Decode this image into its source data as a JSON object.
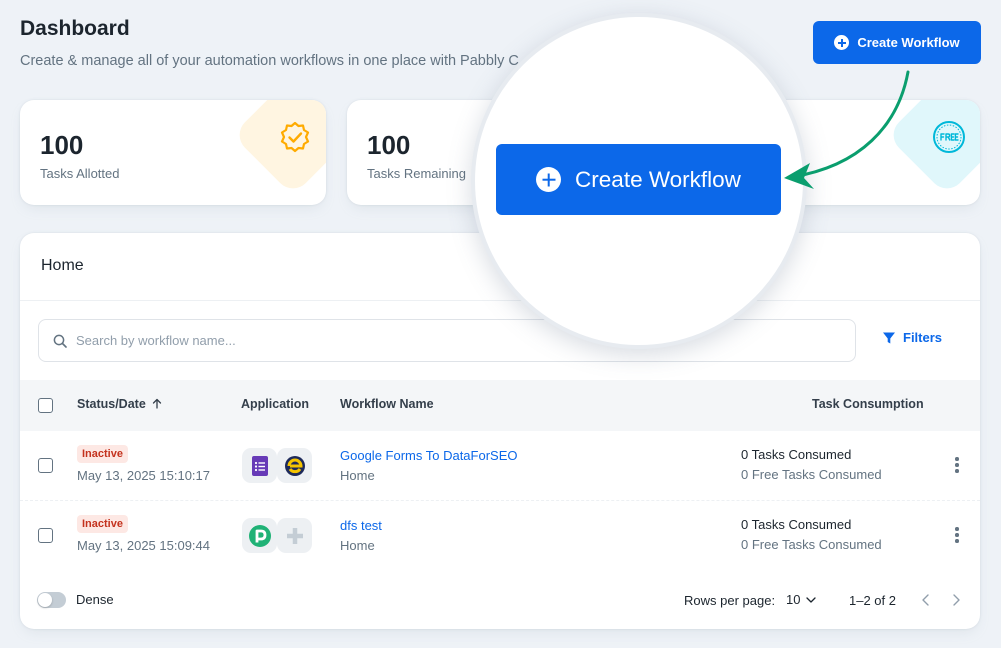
{
  "header": {
    "title": "Dashboard",
    "subtitle": "Create & manage all of your automation workflows in one place with Pabbly C"
  },
  "create_button": {
    "label": "Create Workflow"
  },
  "magnified_button": {
    "label": "Create Workflow"
  },
  "stats": [
    {
      "value": "100",
      "label": "Tasks Allotted",
      "icon": "verified-badge-icon",
      "accent": "#ffab00"
    },
    {
      "value": "100",
      "label": "Tasks Remaining",
      "icon": "",
      "accent": ""
    },
    {
      "value": "",
      "label": "",
      "icon": "free-badge-icon",
      "accent": "#00b8d9"
    }
  ],
  "workflows_panel": {
    "title": "Home",
    "search": {
      "placeholder": "Search by workflow name...",
      "value": ""
    },
    "filters_label": "Filters",
    "columns": {
      "status_date": "Status/Date",
      "application": "Application",
      "workflow_name": "Workflow Name",
      "task_consumption": "Task Consumption"
    },
    "rows": [
      {
        "status": "Inactive",
        "date": "May 13, 2025 15:10:17",
        "apps": [
          "google-forms-icon",
          "dataforseo-icon"
        ],
        "name": "Google Forms To DataForSEO",
        "folder": "Home",
        "tasks_consumed": "0 Tasks Consumed",
        "free_tasks_consumed": "0 Free Tasks Consumed"
      },
      {
        "status": "Inactive",
        "date": "May 13, 2025 15:09:44",
        "apps": [
          "pabbly-icon",
          "add-app-icon"
        ],
        "name": "dfs test",
        "folder": "Home",
        "tasks_consumed": "0 Tasks Consumed",
        "free_tasks_consumed": "0 Free Tasks Consumed"
      }
    ],
    "footer": {
      "dense_label": "Dense",
      "rows_per_page_label": "Rows per page:",
      "rows_per_page_value": "10",
      "page_info": "1–2 of 2"
    }
  },
  "colors": {
    "primary": "#0c68e9",
    "arrow": "#0a9e6e",
    "badge_bg": "#fde8e4",
    "badge_text": "#c4321e"
  }
}
